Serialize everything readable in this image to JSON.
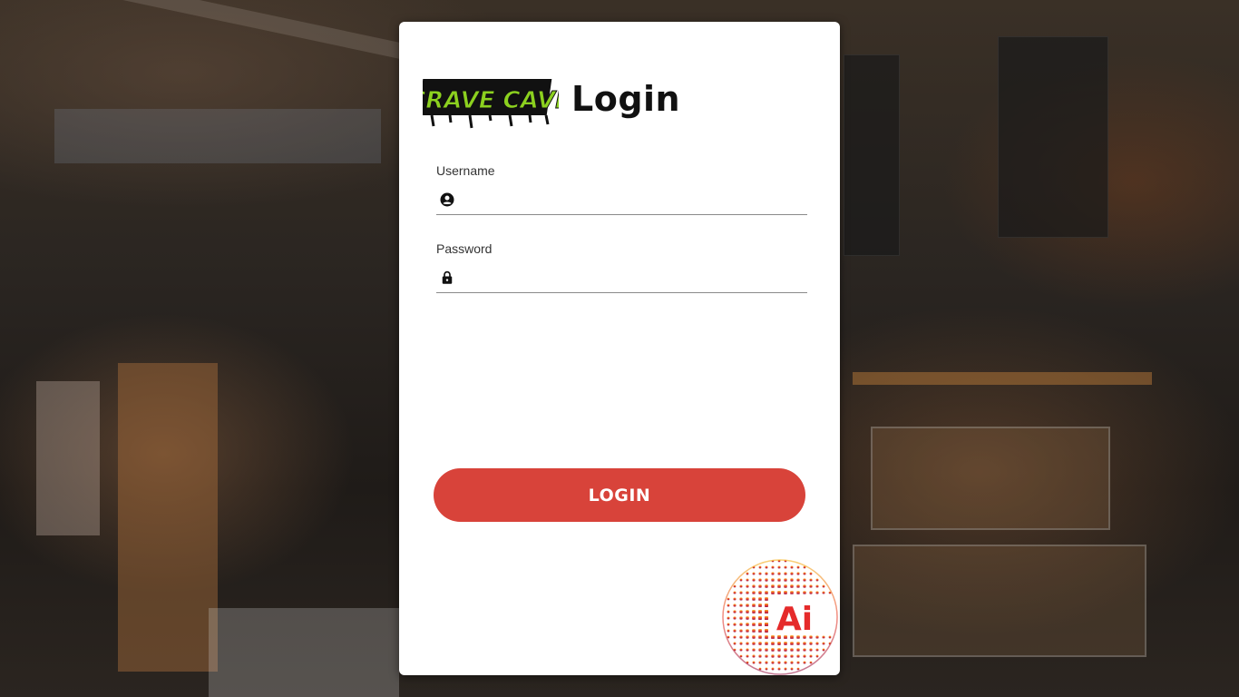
{
  "brand": {
    "logo_text": "CRAVE CAVE",
    "logo_color": "#8cd11f"
  },
  "login": {
    "title": "Login",
    "username_label": "Username",
    "username_value": "",
    "password_label": "Password",
    "password_value": "",
    "button_label": "LOGIN"
  },
  "footer_logo": {
    "text": "Ai",
    "text_color": "#e52a2a"
  },
  "colors": {
    "accent": "#d8433a",
    "card": "#ffffff"
  },
  "icons": {
    "username": "account-circle-icon",
    "password": "lock-icon"
  }
}
